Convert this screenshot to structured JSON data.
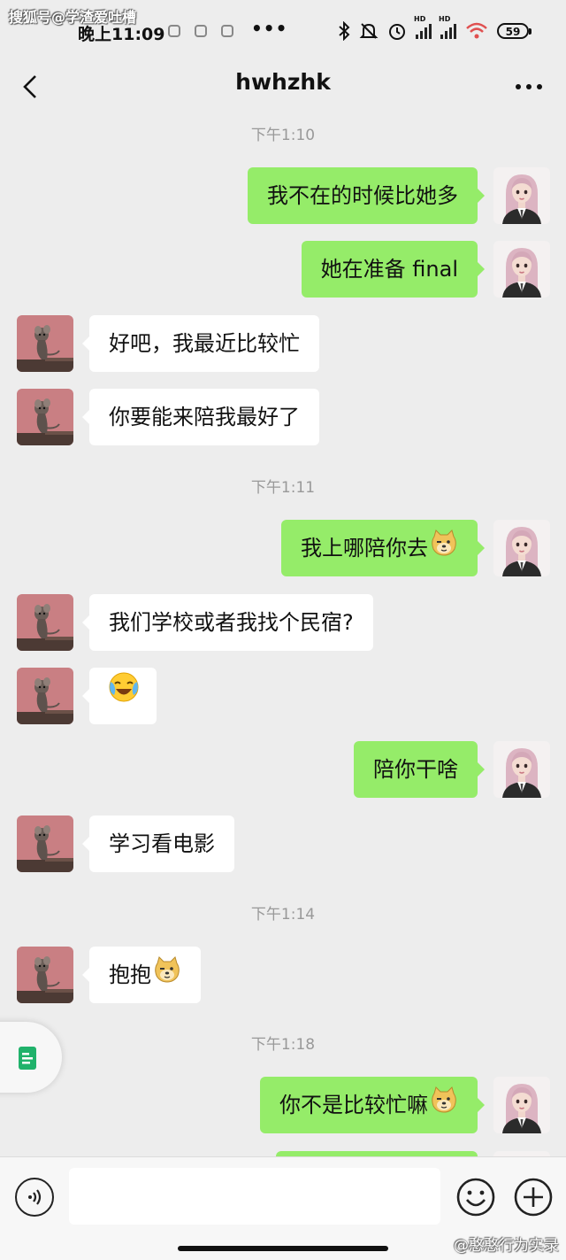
{
  "status_bar": {
    "time": "晚上11:09",
    "dots": "•••",
    "battery": "59",
    "network_label": "HD"
  },
  "watermarks": {
    "top": "搜狐号@学渣爱吐槽",
    "bottom": "@憨憨行为实录"
  },
  "header": {
    "title": "hwhzhk",
    "back_icon": "chevron-left-icon",
    "more_icon": "more-dots-icon"
  },
  "conversation": {
    "timestamps": [
      "下午1:10",
      "下午1:11",
      "下午1:14",
      "下午1:18"
    ],
    "messages": [
      {
        "side": "out",
        "text": "我不在的时候比她多"
      },
      {
        "side": "out",
        "text": "她在准备 final"
      },
      {
        "side": "in",
        "text": "好吧，我最近比较忙"
      },
      {
        "side": "in",
        "text": "你要能来陪我最好了"
      },
      {
        "side": "out",
        "text": "我上哪陪你去",
        "emoji": "doge-icon"
      },
      {
        "side": "in",
        "text": "我们学校或者我找个民宿?"
      },
      {
        "side": "in",
        "text": "",
        "emoji": "laughing-crying-icon"
      },
      {
        "side": "out",
        "text": "陪你干啥"
      },
      {
        "side": "in",
        "text": "学习看电影"
      },
      {
        "side": "in",
        "text": "抱抱",
        "emoji": "doge-icon"
      },
      {
        "side": "out",
        "text": "你不是比较忙嘛",
        "emoji": "doge-icon"
      }
    ]
  },
  "input_bar": {
    "placeholder": "",
    "voice_icon": "voice-icon",
    "emoji_icon": "smiley-icon",
    "plus_icon": "plus-icon"
  },
  "colors": {
    "background": "#ededed",
    "outgoing_bubble": "#95ec69",
    "incoming_bubble": "#ffffff",
    "timestamp_text": "#999999"
  }
}
